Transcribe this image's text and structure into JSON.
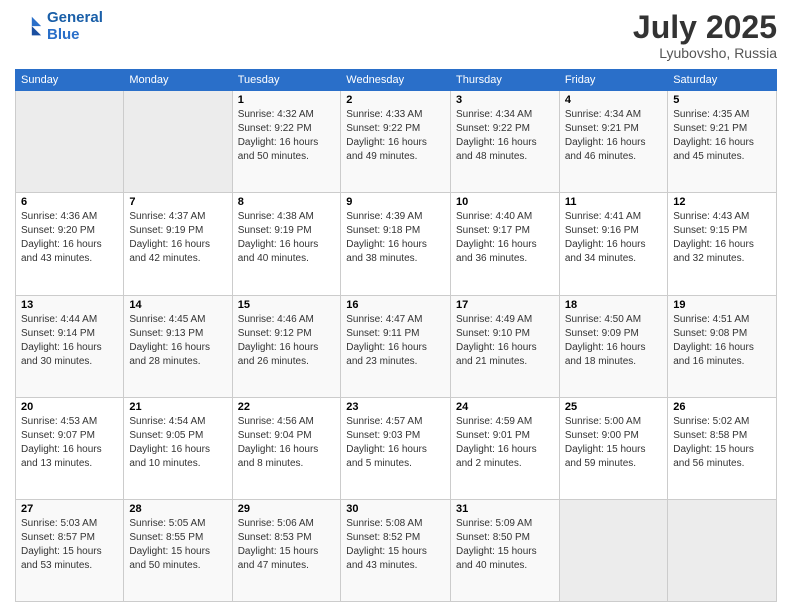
{
  "header": {
    "logo_line1": "General",
    "logo_line2": "Blue",
    "month_year": "July 2025",
    "location": "Lyubovsho, Russia"
  },
  "days_of_week": [
    "Sunday",
    "Monday",
    "Tuesday",
    "Wednesday",
    "Thursday",
    "Friday",
    "Saturday"
  ],
  "weeks": [
    [
      {
        "num": "",
        "empty": true
      },
      {
        "num": "",
        "empty": true
      },
      {
        "num": "1",
        "sunrise": "4:32 AM",
        "sunset": "9:22 PM",
        "daylight": "16 hours and 50 minutes."
      },
      {
        "num": "2",
        "sunrise": "4:33 AM",
        "sunset": "9:22 PM",
        "daylight": "16 hours and 49 minutes."
      },
      {
        "num": "3",
        "sunrise": "4:34 AM",
        "sunset": "9:22 PM",
        "daylight": "16 hours and 48 minutes."
      },
      {
        "num": "4",
        "sunrise": "4:34 AM",
        "sunset": "9:21 PM",
        "daylight": "16 hours and 46 minutes."
      },
      {
        "num": "5",
        "sunrise": "4:35 AM",
        "sunset": "9:21 PM",
        "daylight": "16 hours and 45 minutes."
      }
    ],
    [
      {
        "num": "6",
        "sunrise": "4:36 AM",
        "sunset": "9:20 PM",
        "daylight": "16 hours and 43 minutes."
      },
      {
        "num": "7",
        "sunrise": "4:37 AM",
        "sunset": "9:19 PM",
        "daylight": "16 hours and 42 minutes."
      },
      {
        "num": "8",
        "sunrise": "4:38 AM",
        "sunset": "9:19 PM",
        "daylight": "16 hours and 40 minutes."
      },
      {
        "num": "9",
        "sunrise": "4:39 AM",
        "sunset": "9:18 PM",
        "daylight": "16 hours and 38 minutes."
      },
      {
        "num": "10",
        "sunrise": "4:40 AM",
        "sunset": "9:17 PM",
        "daylight": "16 hours and 36 minutes."
      },
      {
        "num": "11",
        "sunrise": "4:41 AM",
        "sunset": "9:16 PM",
        "daylight": "16 hours and 34 minutes."
      },
      {
        "num": "12",
        "sunrise": "4:43 AM",
        "sunset": "9:15 PM",
        "daylight": "16 hours and 32 minutes."
      }
    ],
    [
      {
        "num": "13",
        "sunrise": "4:44 AM",
        "sunset": "9:14 PM",
        "daylight": "16 hours and 30 minutes."
      },
      {
        "num": "14",
        "sunrise": "4:45 AM",
        "sunset": "9:13 PM",
        "daylight": "16 hours and 28 minutes."
      },
      {
        "num": "15",
        "sunrise": "4:46 AM",
        "sunset": "9:12 PM",
        "daylight": "16 hours and 26 minutes."
      },
      {
        "num": "16",
        "sunrise": "4:47 AM",
        "sunset": "9:11 PM",
        "daylight": "16 hours and 23 minutes."
      },
      {
        "num": "17",
        "sunrise": "4:49 AM",
        "sunset": "9:10 PM",
        "daylight": "16 hours and 21 minutes."
      },
      {
        "num": "18",
        "sunrise": "4:50 AM",
        "sunset": "9:09 PM",
        "daylight": "16 hours and 18 minutes."
      },
      {
        "num": "19",
        "sunrise": "4:51 AM",
        "sunset": "9:08 PM",
        "daylight": "16 hours and 16 minutes."
      }
    ],
    [
      {
        "num": "20",
        "sunrise": "4:53 AM",
        "sunset": "9:07 PM",
        "daylight": "16 hours and 13 minutes."
      },
      {
        "num": "21",
        "sunrise": "4:54 AM",
        "sunset": "9:05 PM",
        "daylight": "16 hours and 10 minutes."
      },
      {
        "num": "22",
        "sunrise": "4:56 AM",
        "sunset": "9:04 PM",
        "daylight": "16 hours and 8 minutes."
      },
      {
        "num": "23",
        "sunrise": "4:57 AM",
        "sunset": "9:03 PM",
        "daylight": "16 hours and 5 minutes."
      },
      {
        "num": "24",
        "sunrise": "4:59 AM",
        "sunset": "9:01 PM",
        "daylight": "16 hours and 2 minutes."
      },
      {
        "num": "25",
        "sunrise": "5:00 AM",
        "sunset": "9:00 PM",
        "daylight": "15 hours and 59 minutes."
      },
      {
        "num": "26",
        "sunrise": "5:02 AM",
        "sunset": "8:58 PM",
        "daylight": "15 hours and 56 minutes."
      }
    ],
    [
      {
        "num": "27",
        "sunrise": "5:03 AM",
        "sunset": "8:57 PM",
        "daylight": "15 hours and 53 minutes."
      },
      {
        "num": "28",
        "sunrise": "5:05 AM",
        "sunset": "8:55 PM",
        "daylight": "15 hours and 50 minutes."
      },
      {
        "num": "29",
        "sunrise": "5:06 AM",
        "sunset": "8:53 PM",
        "daylight": "15 hours and 47 minutes."
      },
      {
        "num": "30",
        "sunrise": "5:08 AM",
        "sunset": "8:52 PM",
        "daylight": "15 hours and 43 minutes."
      },
      {
        "num": "31",
        "sunrise": "5:09 AM",
        "sunset": "8:50 PM",
        "daylight": "15 hours and 40 minutes."
      },
      {
        "num": "",
        "empty": true
      },
      {
        "num": "",
        "empty": true
      }
    ]
  ],
  "labels": {
    "sunrise_prefix": "Sunrise: ",
    "sunset_prefix": "Sunset: ",
    "daylight_prefix": "Daylight: "
  }
}
